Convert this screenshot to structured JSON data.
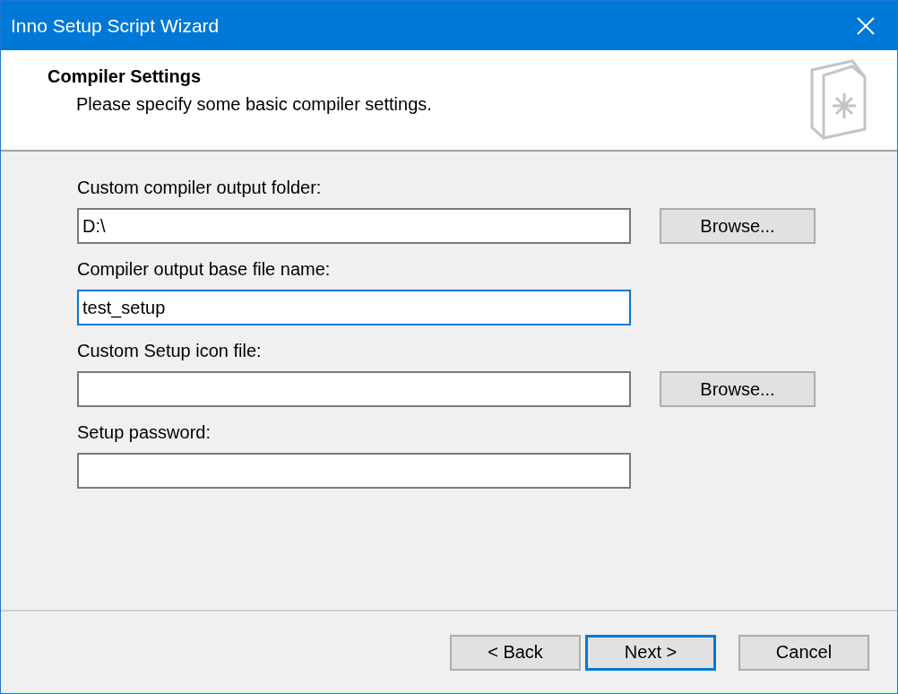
{
  "window": {
    "title": "Inno Setup Script Wizard"
  },
  "header": {
    "title": "Compiler Settings",
    "subtitle": "Please specify some basic compiler settings."
  },
  "fields": [
    {
      "label": "Custom compiler output folder:",
      "value": "D:\\",
      "focused": false,
      "button": "Browse..."
    },
    {
      "label": "Compiler output base file name:",
      "value": "test_setup",
      "focused": true
    },
    {
      "label": "Custom Setup icon file:",
      "focused": false,
      "button": "Browse..."
    },
    {
      "label": "Setup password:",
      "focused": false
    }
  ],
  "buttons": [
    {
      "label": "< Back",
      "default": false
    },
    {
      "label": "Next >",
      "default": true
    },
    {
      "label": "Cancel",
      "default": false
    }
  ]
}
